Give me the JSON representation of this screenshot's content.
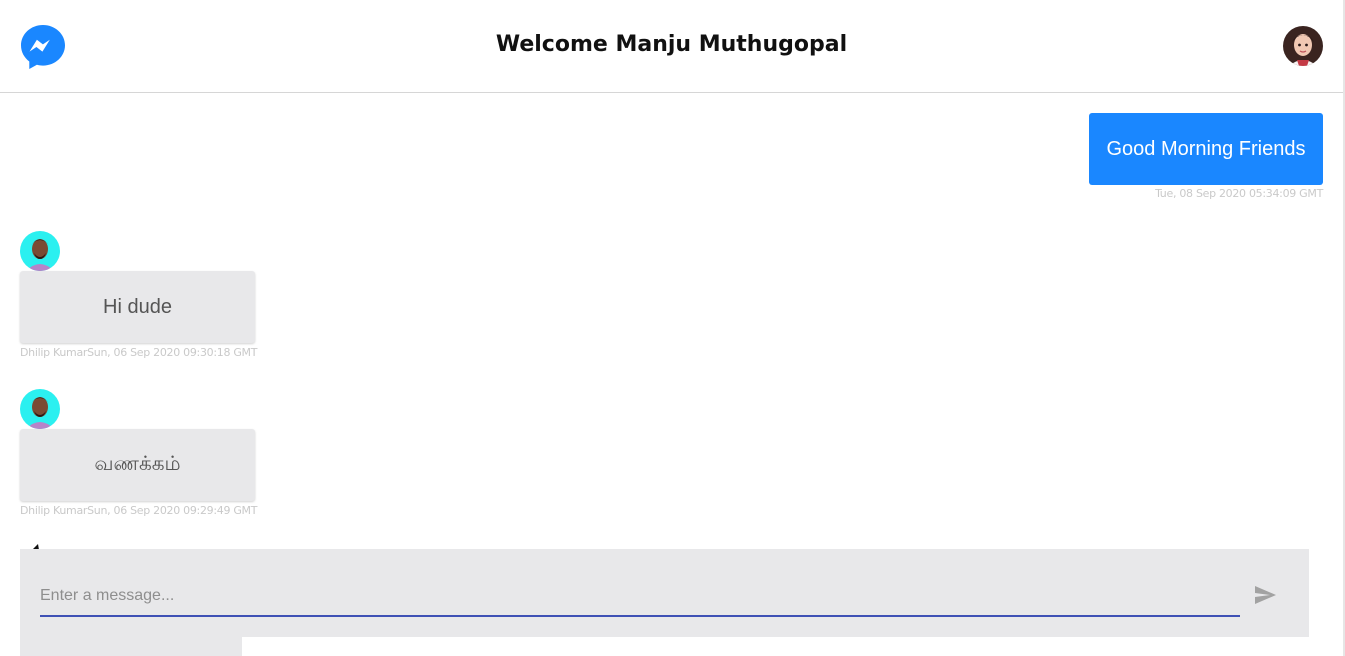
{
  "header": {
    "title": "Welcome Manju Muthugopal",
    "logo_icon": "messenger-icon",
    "avatar_icon": "user-avatar"
  },
  "messages": [
    {
      "direction": "outgoing",
      "text": "Good Morning Friends",
      "meta": "Tue, 08 Sep 2020 05:34:09 GMT"
    },
    {
      "direction": "incoming",
      "text": "Hi dude",
      "meta": "Dhilip KumarSun, 06 Sep 2020 09:30:18 GMT"
    },
    {
      "direction": "incoming",
      "text": "வணக்கம்",
      "meta": "Dhilip KumarSun, 06 Sep 2020 09:29:49 GMT"
    }
  ],
  "composer": {
    "placeholder": "Enter a message...",
    "value": "",
    "send_icon": "send-icon"
  },
  "colors": {
    "outgoing_bubble": "#1a87ff",
    "incoming_bubble": "#e8e8ea",
    "input_underline": "#3f51b5",
    "messenger_blue": "#1a87ff"
  }
}
